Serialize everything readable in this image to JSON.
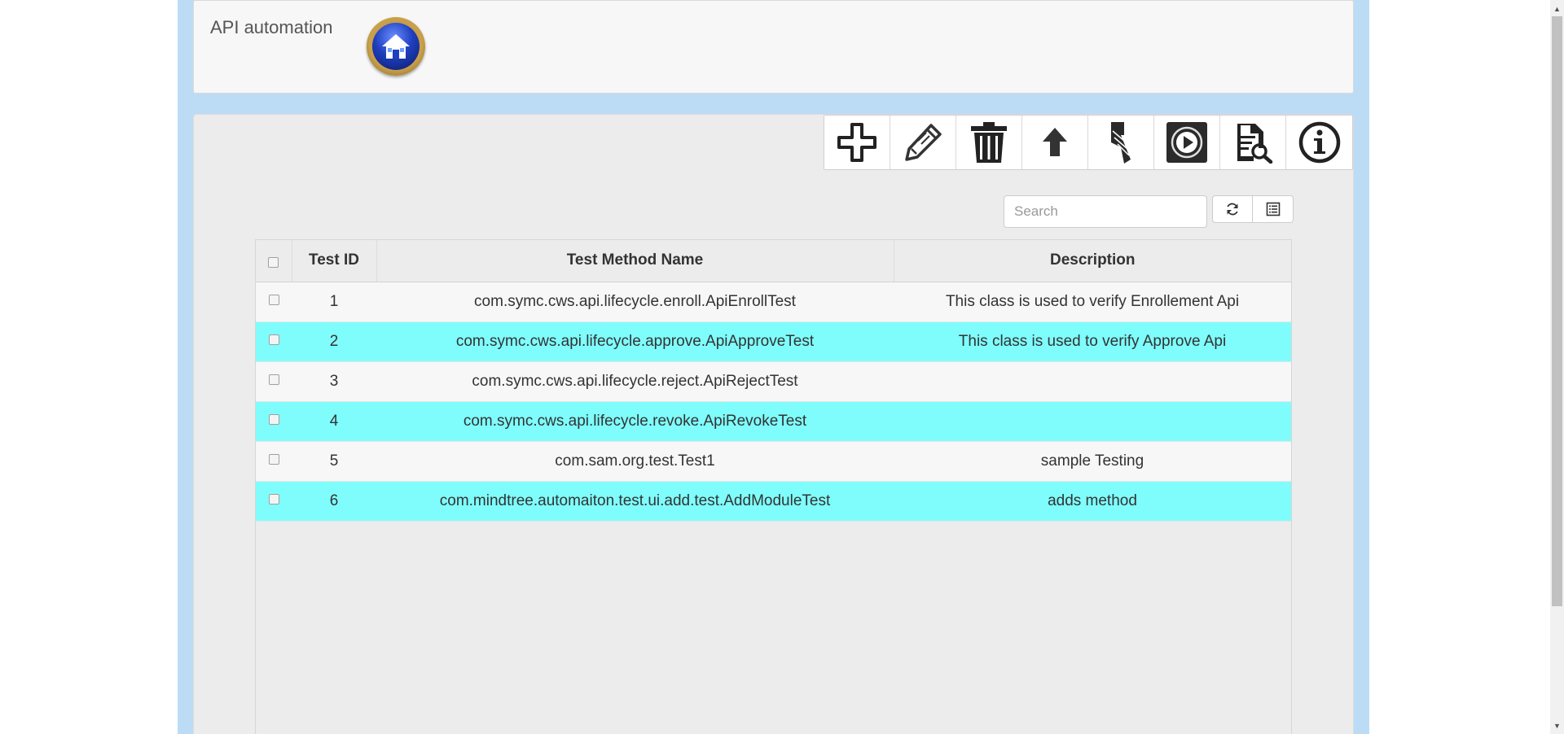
{
  "header": {
    "title": "API automation",
    "home_icon": "home-icon"
  },
  "toolbar": {
    "buttons": [
      {
        "name": "add",
        "icon": "plus-icon"
      },
      {
        "name": "edit",
        "icon": "pencil-icon"
      },
      {
        "name": "delete",
        "icon": "trash-icon"
      },
      {
        "name": "upload",
        "icon": "arrow-up-icon"
      },
      {
        "name": "drill",
        "icon": "drill-icon"
      },
      {
        "name": "run",
        "icon": "play-icon"
      },
      {
        "name": "view-report",
        "icon": "document-search-icon"
      },
      {
        "name": "info",
        "icon": "info-icon"
      }
    ]
  },
  "search": {
    "placeholder": "Search",
    "value": ""
  },
  "table": {
    "columns": [
      "Test ID",
      "Test Method Name",
      "Description"
    ],
    "rows": [
      {
        "id": "1",
        "method": "com.symc.cws.api.lifecycle.enroll.ApiEnrollTest",
        "description": "This class is used to verify Enrollement Api"
      },
      {
        "id": "2",
        "method": "com.symc.cws.api.lifecycle.approve.ApiApproveTest",
        "description": "This class is used to verify Approve Api"
      },
      {
        "id": "3",
        "method": "com.symc.cws.api.lifecycle.reject.ApiRejectTest",
        "description": ""
      },
      {
        "id": "4",
        "method": "com.symc.cws.api.lifecycle.revoke.ApiRevokeTest",
        "description": ""
      },
      {
        "id": "5",
        "method": "com.sam.org.test.Test1",
        "description": "sample Testing"
      },
      {
        "id": "6",
        "method": "com.mindtree.automaiton.test.ui.add.test.AddModuleTest",
        "description": "adds method"
      }
    ]
  },
  "colors": {
    "page_bg": "#bcdcf6",
    "row_highlight": "#7ffdfd",
    "row_normal": "#f7f7f7"
  }
}
